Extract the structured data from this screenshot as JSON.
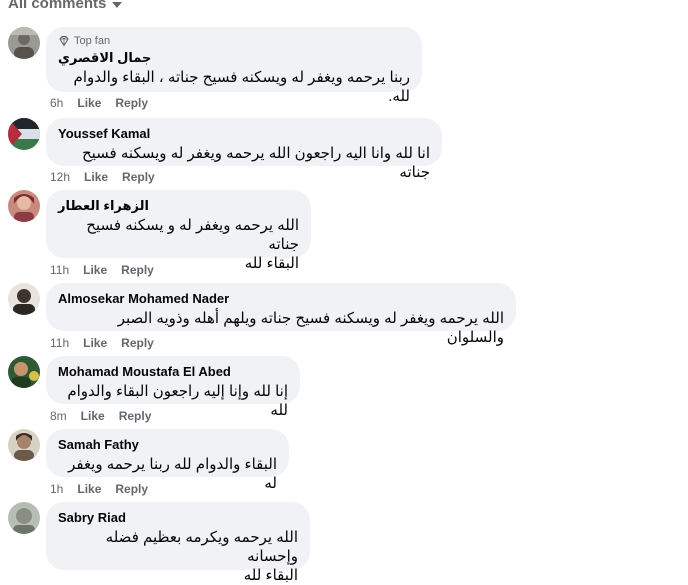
{
  "header": {
    "filter_label": "All comments"
  },
  "comments": [
    {
      "badge": "Top fan",
      "author": "جمال الاقصري",
      "text": "ربنا يرحمه ويغفر له ويسكنه فسيح جناته ، البقاء والدوام لله.",
      "time": "6h",
      "like": "Like",
      "reply": "Reply"
    },
    {
      "author": "Youssef Kamal",
      "text": "انا لله وانا اليه راجعون الله يرحمه ويغفر له ويسكنه فسيح جناته",
      "time": "12h",
      "like": "Like",
      "reply": "Reply"
    },
    {
      "author": "الزهراء العطار",
      "text_lines": [
        "الله يرحمه ويغفر له و يسكنه فسيح جناته",
        "البقاء لله"
      ],
      "time": "11h",
      "like": "Like",
      "reply": "Reply"
    },
    {
      "author": "Almosekar Mohamed Nader",
      "text": "الله يرحمه ويغفر له ويسكنه فسيح جناته ويلهم أهله وذويه الصبر والسلوان",
      "time": "11h",
      "like": "Like",
      "reply": "Reply"
    },
    {
      "author": "Mohamad Moustafa El Abed",
      "text": "إنا لله وإنا إليه راجعون البقاء والدوام لله",
      "time": "8m",
      "like": "Like",
      "reply": "Reply"
    },
    {
      "author": "Samah Fathy",
      "text": "البقاء والدوام لله ربنا يرحمه ويغفر له",
      "time": "1h",
      "like": "Like",
      "reply": "Reply"
    },
    {
      "author": "Sabry Riad",
      "text_lines": [
        "الله يرحمه ويكرمه بعظيم فضله وإحسانه",
        "البقاء لله"
      ],
      "time": "",
      "like": "",
      "reply": ""
    }
  ]
}
